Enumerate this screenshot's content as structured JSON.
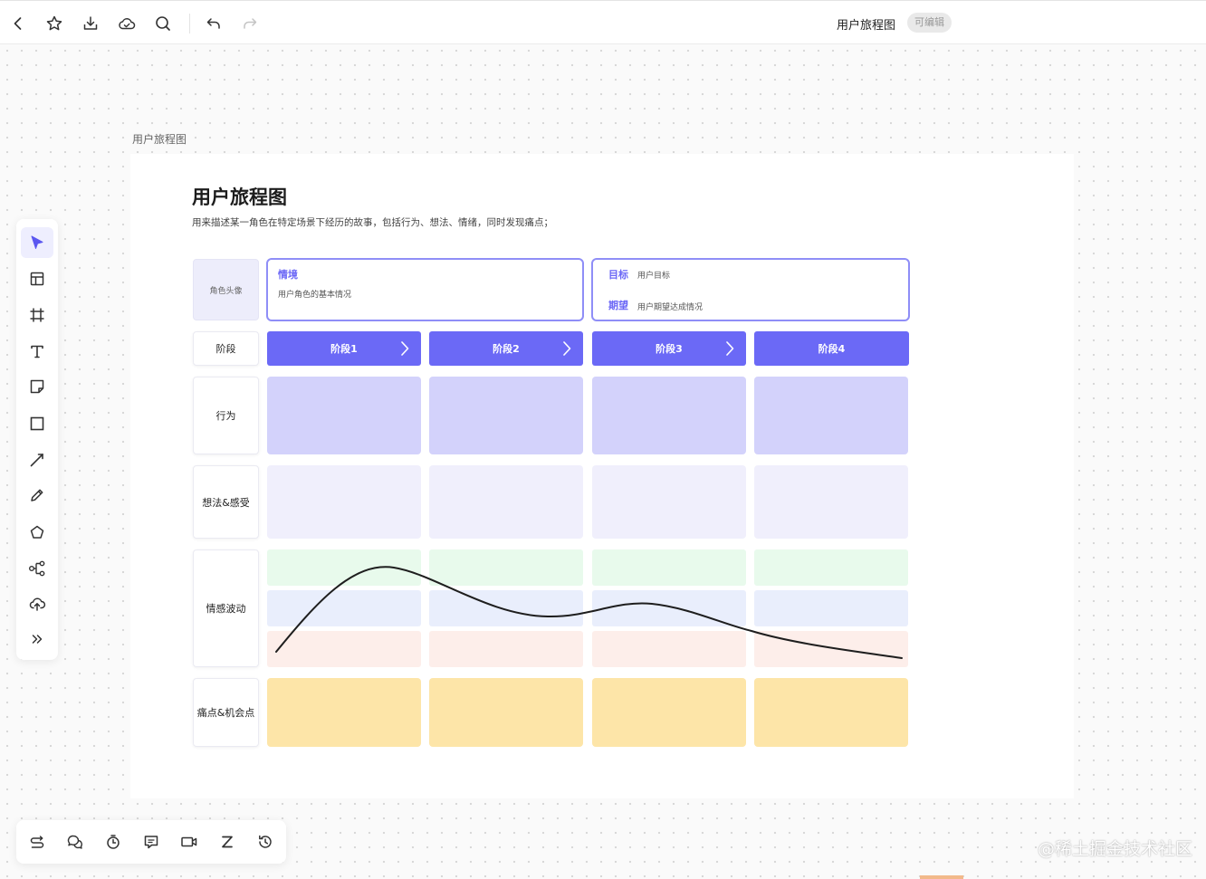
{
  "header": {
    "doc_title": "用户旅程图",
    "edit_badge": "可编辑"
  },
  "frame": {
    "label": "用户旅程图"
  },
  "board": {
    "title": "用户旅程图",
    "description": "用来描述某一角色在特定场景下经历的故事，包括行为、想法、情绪，同时发现痛点；"
  },
  "journey": {
    "avatar": "角色头像",
    "context": {
      "label": "情境",
      "text": "用户角色的基本情况"
    },
    "goal": {
      "label": "目标",
      "text": "用户目标"
    },
    "expect": {
      "label": "期望",
      "text": "用户期望达成情况"
    },
    "rows": {
      "stage": "阶段",
      "behavior": "行为",
      "thoughts": "想法&感受",
      "emotion": "情感波动",
      "pain": "痛点&机会点"
    },
    "stages": [
      "阶段1",
      "阶段2",
      "阶段3",
      "阶段4"
    ]
  },
  "watermark": "@稀土掘金技术社区",
  "colors": {
    "accent": "#6b69f6",
    "behavior": "#d3d2fb",
    "thoughts": "#f0effc",
    "pain": "#fde5a8",
    "emotion_positive": "#e8faec",
    "emotion_neutral": "#e9eefc",
    "emotion_negative": "#fdeeea"
  },
  "icons": {
    "topbar": [
      "back-icon",
      "star-icon",
      "download-icon",
      "cloud-icon",
      "search-icon",
      "undo-icon",
      "redo-icon"
    ],
    "left_toolbar": [
      "select-icon",
      "layout-icon",
      "frame-icon",
      "text-icon",
      "sticky-note-icon",
      "rectangle-icon",
      "line-icon",
      "pen-icon",
      "polygon-icon",
      "mindmap-icon",
      "upload-icon",
      "more-icon"
    ],
    "bottom_toolbar": [
      "switch-icon",
      "comments-icon",
      "timer-icon",
      "chat-icon",
      "video-icon",
      "sleep-icon",
      "history-icon"
    ]
  }
}
